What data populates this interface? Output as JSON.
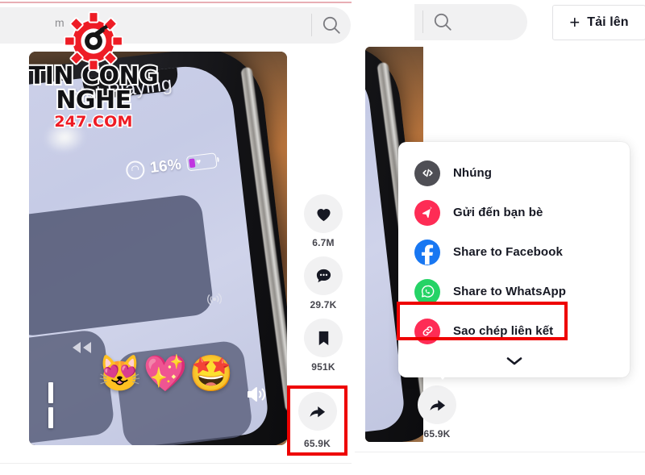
{
  "meta": {
    "app": "TikTok",
    "language": "vi"
  },
  "watermark": {
    "title": "TIN CONG NGHE",
    "subtitle": "247.COM",
    "logo_icon": "gear-icon",
    "red": "#ee1c25"
  },
  "panel_one": {
    "search": {
      "value": "m",
      "icon": "search-icon"
    },
    "video": {
      "phone_screen": {
        "battery_percent": "16%",
        "lock_icon": "lock-circle-icon",
        "battery_icon": "battery-icon",
        "battery_heart": "♥",
        "now_playing_label": "Not Playing",
        "airplay_icon": "airplay-icon",
        "rewind_icon": "rewind-icon"
      },
      "emojis": [
        "😻",
        "💖",
        "🤩"
      ],
      "controls": {
        "pause_icon": "pause-icon",
        "volume_icon": "volume-icon"
      }
    },
    "engagement": [
      {
        "name": "like",
        "icon": "heart-icon",
        "count": "6.7M"
      },
      {
        "name": "comment",
        "icon": "comment-icon",
        "count": "29.7K"
      },
      {
        "name": "bookmark",
        "icon": "bookmark-icon",
        "count": "951K"
      },
      {
        "name": "share",
        "icon": "share-arrow-icon",
        "count": "65.9K"
      }
    ],
    "highlight": {
      "target": "share-button",
      "color": "#ee0000"
    }
  },
  "panel_two": {
    "search": {
      "value": "",
      "icon": "search-icon"
    },
    "upload_button": {
      "plus": "+",
      "label": "Tải lên",
      "icon": "plus-icon"
    },
    "share_menu": {
      "items": [
        {
          "label": "Nhúng",
          "icon": "embed-code-icon",
          "color": "#4f4f55"
        },
        {
          "label": "Gửi đến bạn bè",
          "icon": "send-paper-plane-icon",
          "color": "#fe2c55"
        },
        {
          "label": "Share to Facebook",
          "icon": "facebook-icon",
          "color": "#1877f2"
        },
        {
          "label": "Share to WhatsApp",
          "icon": "whatsapp-icon",
          "color": "#25d366"
        },
        {
          "label": "Sao chép liên kết",
          "icon": "link-chain-icon",
          "color": "#fe2c55"
        }
      ],
      "expand_icon": "chevron-down-icon",
      "highlighted_item": "Sao chép liên kết"
    },
    "share_button": {
      "icon": "share-arrow-icon",
      "count": "65.9K"
    }
  }
}
